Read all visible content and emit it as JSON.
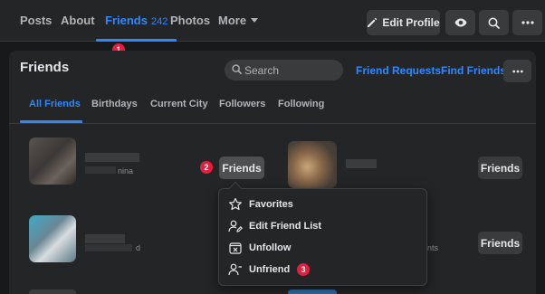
{
  "topnav": {
    "tabs": [
      {
        "label": "Posts"
      },
      {
        "label": "About"
      },
      {
        "label": "Friends",
        "count": "242"
      },
      {
        "label": "Photos"
      },
      {
        "label": "More"
      }
    ],
    "edit_profile_label": "Edit Profile",
    "step_badge": "1"
  },
  "panel": {
    "title": "Friends",
    "search_placeholder": "Search",
    "friend_requests_label": "Friend Requests",
    "find_friends_label": "Find Friends",
    "subtabs": [
      "All Friends",
      "Birthdays",
      "Current City",
      "Followers",
      "Following"
    ]
  },
  "cards": [
    {
      "button_label": "Friends",
      "subtext_fragment": "nina"
    },
    {
      "button_label": "Friends"
    },
    {
      "subtext_fragment": "d"
    },
    {
      "button_label": "Friends",
      "subtext_fragment": "nts"
    }
  ],
  "step_badges": {
    "friends_button": "2",
    "unfriend": "3"
  },
  "menu": {
    "items": [
      {
        "label": "Favorites",
        "icon": "star-icon"
      },
      {
        "label": "Edit Friend List",
        "icon": "edit-list-icon"
      },
      {
        "label": "Unfollow",
        "icon": "unfollow-icon"
      },
      {
        "label": "Unfriend",
        "icon": "unfriend-icon"
      }
    ]
  },
  "colors": {
    "accent": "#2d88ff",
    "background": "#18191a",
    "surface": "#242526",
    "button": "#3a3b3c",
    "badge": "#e41e3f"
  }
}
